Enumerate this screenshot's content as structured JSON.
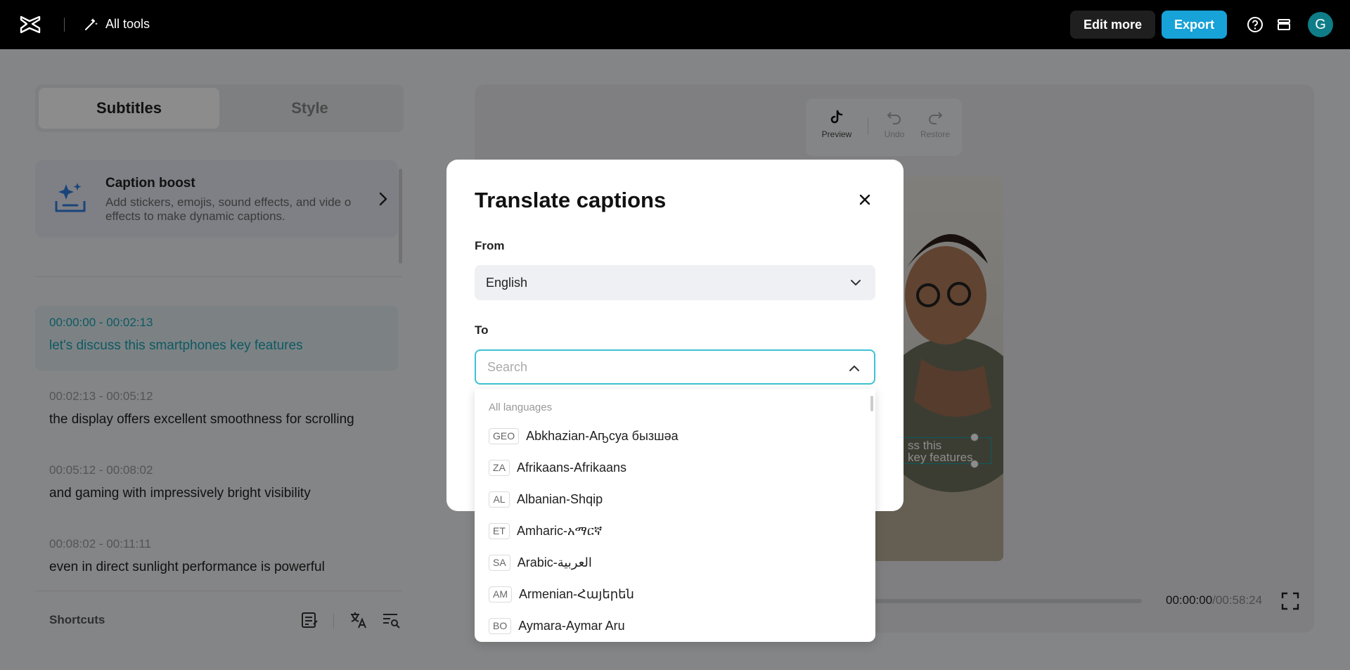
{
  "topbar": {
    "logo": "capcut-logo-icon",
    "all_tools": "All tools",
    "edit_more": "Edit more",
    "export": "Export",
    "avatar_initial": "G"
  },
  "left_panel": {
    "tabs": [
      "Subtitles",
      "Style"
    ],
    "active_tab": "Subtitles",
    "caption_boost": {
      "title": "Caption boost",
      "description": "Add stickers, emojis, sound effects, and vide o effects to make dynamic captions."
    },
    "subtitles": [
      {
        "time": "00:00:00 - 00:02:13",
        "text": "let's discuss this smartphones key features"
      },
      {
        "time": "00:02:13  - 00:05:12",
        "text": "the display offers excellent smoothness for scrolling"
      },
      {
        "time": "00:05:12  - 00:08:02",
        "text": "and gaming with impressively bright visibility"
      },
      {
        "time": "00:08:02 - 00:11:11",
        "text": "even in direct sunlight performance is powerful"
      }
    ],
    "shortcuts_label": "Shortcuts"
  },
  "stage": {
    "tools": {
      "preview": "Preview",
      "undo": "Undo",
      "restore": "Restore"
    },
    "overlay_caption_line1": "ss this",
    "overlay_caption_line2": "key features",
    "time_current": "00:00:00",
    "time_total": "/00:58:24"
  },
  "modal": {
    "title": "Translate captions",
    "from_label": "From",
    "from_value": "English",
    "to_label": "To",
    "to_placeholder": "Search",
    "dropdown_header": "All languages",
    "languages": [
      {
        "code": "GEO",
        "name": "Abkhazian-Аҧсуа бызшәа"
      },
      {
        "code": "ZA",
        "name": "Afrikaans-Afrikaans"
      },
      {
        "code": "AL",
        "name": "Albanian-Shqip"
      },
      {
        "code": "ET",
        "name": "Amharic-አማርኛ"
      },
      {
        "code": "SA",
        "name": "Arabic-العربية"
      },
      {
        "code": "AM",
        "name": "Armenian-Հայերեն"
      },
      {
        "code": "BO",
        "name": "Aymara-Aymar Aru"
      }
    ]
  },
  "colors": {
    "accent": "#17a2d8",
    "active_text": "#1aa3b4",
    "topbar": "#000000"
  }
}
